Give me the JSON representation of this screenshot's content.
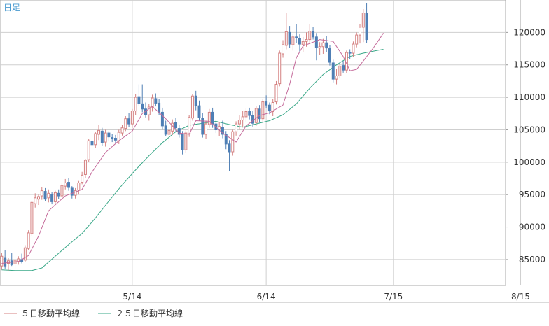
{
  "chart_data": {
    "type": "candlestick",
    "period_label": "日足",
    "x_tick_labels": [
      "5/14",
      "6/14",
      "7/15",
      "8/15"
    ],
    "y_tick_labels": [
      "85000",
      "90000",
      "95000",
      "100000",
      "105000",
      "110000",
      "115000",
      "120000"
    ],
    "ylim": [
      81000,
      125000
    ],
    "grid": true,
    "legend": [
      {
        "label": "５日移動平均線",
        "color": "#d48080"
      },
      {
        "label": "２５日移動平均線",
        "color": "#3aa888"
      }
    ],
    "colors": {
      "up": "#d48080",
      "down": "#4f7fb5",
      "ma5": "#c46a9a",
      "ma25": "#3aa888",
      "grid": "#cfcfcf",
      "axis": "#999999",
      "label": "#333333",
      "title": "#4a9bd0"
    },
    "candles_count": 151,
    "x_tick_candle_index": [
      39,
      79,
      117,
      155
    ],
    "candles": [
      [
        84000,
        86000,
        83400,
        85500
      ],
      [
        85200,
        86400,
        83600,
        84000
      ],
      [
        84400,
        85200,
        83300,
        84800
      ],
      [
        84800,
        86000,
        84000,
        84200
      ],
      [
        84300,
        85100,
        83500,
        84900
      ],
      [
        84700,
        85500,
        84200,
        85100
      ],
      [
        85000,
        85900,
        84400,
        84700
      ],
      [
        84900,
        87200,
        84600,
        86800
      ],
      [
        86700,
        89500,
        86400,
        89100
      ],
      [
        89000,
        94000,
        88600,
        93800
      ],
      [
        93600,
        95200,
        93000,
        94500
      ],
      [
        94300,
        95000,
        93400,
        94700
      ],
      [
        94800,
        96200,
        94200,
        95600
      ],
      [
        95500,
        96000,
        94000,
        94300
      ],
      [
        94500,
        95800,
        93800,
        95200
      ],
      [
        95000,
        95400,
        93500,
        93900
      ],
      [
        93900,
        95600,
        93400,
        95300
      ],
      [
        95200,
        95800,
        94300,
        94800
      ],
      [
        94800,
        96800,
        94600,
        96400
      ],
      [
        96300,
        97400,
        95800,
        96800
      ],
      [
        96900,
        97500,
        95600,
        96100
      ],
      [
        96000,
        96300,
        94400,
        94900
      ],
      [
        94900,
        96000,
        94400,
        95600
      ],
      [
        95700,
        97100,
        95000,
        96800
      ],
      [
        96900,
        98500,
        96600,
        98000
      ],
      [
        98100,
        100500,
        97500,
        100300
      ],
      [
        100400,
        103600,
        100000,
        103300
      ],
      [
        103200,
        104500,
        102000,
        102700
      ],
      [
        102700,
        104700,
        102200,
        104400
      ],
      [
        104300,
        105800,
        103400,
        104900
      ],
      [
        104800,
        105300,
        102500,
        103000
      ],
      [
        103100,
        105000,
        102400,
        104500
      ],
      [
        104500,
        104800,
        103200,
        103900
      ],
      [
        103800,
        104400,
        103100,
        103600
      ],
      [
        103700,
        104200,
        102900,
        103400
      ],
      [
        103300,
        105000,
        102800,
        104600
      ],
      [
        104500,
        105700,
        104100,
        105300
      ],
      [
        105200,
        107100,
        104800,
        106700
      ],
      [
        106700,
        107600,
        105400,
        105900
      ],
      [
        105900,
        108200,
        105300,
        107900
      ],
      [
        107900,
        110500,
        107300,
        110000
      ],
      [
        110100,
        112000,
        108600,
        109000
      ],
      [
        109000,
        112000,
        107700,
        108200
      ],
      [
        108200,
        109200,
        106900,
        107300
      ],
      [
        107300,
        109000,
        106400,
        108500
      ],
      [
        108500,
        110400,
        107800,
        109900
      ],
      [
        109800,
        110600,
        108600,
        109100
      ],
      [
        109100,
        109700,
        107300,
        107700
      ],
      [
        107700,
        108400,
        105000,
        105600
      ],
      [
        105600,
        106400,
        104000,
        104300
      ],
      [
        104300,
        105500,
        103000,
        104900
      ],
      [
        104800,
        106600,
        104200,
        106000
      ],
      [
        106100,
        106800,
        104600,
        105300
      ],
      [
        105200,
        105700,
        103800,
        104300
      ],
      [
        104300,
        104800,
        101200,
        101900
      ],
      [
        101900,
        104900,
        101400,
        104500
      ],
      [
        104400,
        107300,
        103900,
        106900
      ],
      [
        106800,
        110500,
        106400,
        110200
      ],
      [
        110200,
        111000,
        108000,
        108700
      ],
      [
        108700,
        109500,
        106400,
        106900
      ],
      [
        106800,
        107600,
        103800,
        104300
      ],
      [
        104300,
        106400,
        103600,
        105900
      ],
      [
        105800,
        108200,
        105300,
        107700
      ],
      [
        107700,
        108400,
        105300,
        105900
      ],
      [
        105900,
        106500,
        104500,
        105000
      ],
      [
        105100,
        106200,
        104000,
        105500
      ],
      [
        105400,
        106400,
        103700,
        104300
      ],
      [
        104300,
        104800,
        102000,
        102800
      ],
      [
        102800,
        103400,
        98600,
        101600
      ],
      [
        101600,
        105000,
        101000,
        104700
      ],
      [
        104700,
        106300,
        104100,
        105900
      ],
      [
        105900,
        107200,
        105000,
        106500
      ],
      [
        106500,
        107900,
        105400,
        107000
      ],
      [
        107000,
        108300,
        106200,
        107800
      ],
      [
        107800,
        108400,
        106600,
        107200
      ],
      [
        107200,
        107900,
        105500,
        106000
      ],
      [
        106100,
        108600,
        105600,
        108300
      ],
      [
        108200,
        108800,
        106100,
        106700
      ],
      [
        106700,
        109700,
        106100,
        109300
      ],
      [
        109300,
        110300,
        108300,
        108800
      ],
      [
        108800,
        109200,
        107400,
        107900
      ],
      [
        107800,
        109700,
        107100,
        109200
      ],
      [
        109300,
        112500,
        108900,
        112000
      ],
      [
        112100,
        117200,
        111700,
        116800
      ],
      [
        116700,
        118800,
        116100,
        118100
      ],
      [
        118000,
        123000,
        117400,
        120100
      ],
      [
        120000,
        121000,
        117600,
        118200
      ],
      [
        118100,
        119800,
        117200,
        119300
      ],
      [
        119300,
        121300,
        118400,
        119200
      ],
      [
        119100,
        119700,
        117000,
        118200
      ],
      [
        118100,
        119300,
        117000,
        118600
      ],
      [
        118600,
        120000,
        117800,
        118900
      ],
      [
        118900,
        121300,
        118400,
        120200
      ],
      [
        120200,
        120800,
        118900,
        119300
      ],
      [
        119300,
        119900,
        115700,
        117700
      ],
      [
        117600,
        118500,
        116500,
        117800
      ],
      [
        117800,
        119000,
        116700,
        118400
      ],
      [
        118400,
        119500,
        117000,
        117600
      ],
      [
        117500,
        118000,
        114900,
        115400
      ],
      [
        115300,
        115800,
        112300,
        112800
      ],
      [
        112800,
        114400,
        112000,
        113300
      ],
      [
        113300,
        115200,
        112900,
        114800
      ],
      [
        114900,
        115600,
        113800,
        114200
      ],
      [
        114200,
        117200,
        113700,
        116900
      ],
      [
        116900,
        117400,
        115900,
        116800
      ],
      [
        116800,
        118600,
        116200,
        118200
      ],
      [
        118200,
        120000,
        117700,
        119600
      ],
      [
        119600,
        121300,
        118300,
        120800
      ],
      [
        120800,
        123600,
        118500,
        123000
      ],
      [
        123000,
        124500,
        118400,
        118900
      ]
    ],
    "ma5": [
      [
        0,
        84400
      ],
      [
        5,
        84700
      ],
      [
        8,
        85600
      ],
      [
        11,
        88600
      ],
      [
        14,
        92500
      ],
      [
        19,
        94800
      ],
      [
        24,
        95800
      ],
      [
        27,
        98500
      ],
      [
        31,
        101500
      ],
      [
        35,
        103300
      ],
      [
        39,
        104800
      ],
      [
        42,
        107500
      ],
      [
        45,
        108600
      ],
      [
        49,
        106700
      ],
      [
        53,
        104500
      ],
      [
        56,
        104300
      ],
      [
        58,
        106400
      ],
      [
        62,
        106300
      ],
      [
        66,
        104500
      ],
      [
        70,
        103100
      ],
      [
        73,
        105600
      ],
      [
        77,
        107200
      ],
      [
        80,
        107600
      ],
      [
        84,
        108800
      ],
      [
        86,
        112000
      ],
      [
        88,
        116100
      ],
      [
        90,
        117900
      ],
      [
        95,
        118900
      ],
      [
        99,
        118600
      ],
      [
        102,
        116300
      ],
      [
        104,
        114100
      ],
      [
        106,
        114300
      ],
      [
        108,
        115600
      ],
      [
        111,
        117600
      ],
      [
        113,
        119100
      ],
      [
        114,
        119900
      ]
    ],
    "ma25": [
      [
        0,
        83400
      ],
      [
        4,
        83300
      ],
      [
        9,
        83300
      ],
      [
        12,
        83700
      ],
      [
        16,
        85500
      ],
      [
        20,
        87300
      ],
      [
        24,
        89000
      ],
      [
        28,
        91400
      ],
      [
        32,
        94000
      ],
      [
        36,
        96500
      ],
      [
        40,
        98800
      ],
      [
        44,
        101000
      ],
      [
        48,
        103000
      ],
      [
        52,
        104700
      ],
      [
        56,
        105700
      ],
      [
        60,
        106000
      ],
      [
        64,
        106300
      ],
      [
        68,
        105800
      ],
      [
        72,
        105400
      ],
      [
        76,
        105900
      ],
      [
        80,
        106400
      ],
      [
        84,
        107300
      ],
      [
        88,
        109000
      ],
      [
        92,
        111400
      ],
      [
        96,
        113500
      ],
      [
        100,
        115000
      ],
      [
        104,
        116300
      ],
      [
        108,
        116800
      ],
      [
        112,
        117200
      ],
      [
        114,
        117400
      ]
    ]
  }
}
